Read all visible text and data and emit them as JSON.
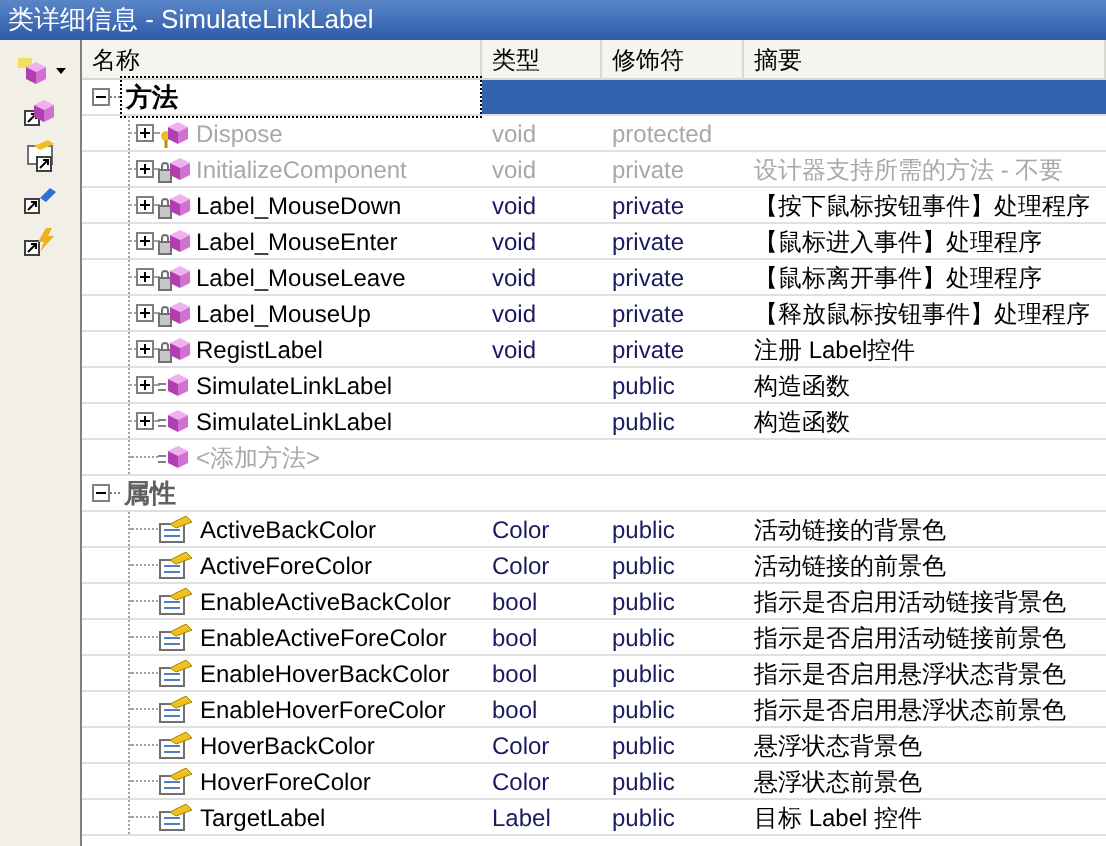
{
  "window": {
    "title": "类详细信息 - SimulateLinkLabel"
  },
  "columns": [
    "名称",
    "类型",
    "修饰符",
    "摘要"
  ],
  "groups": [
    {
      "label": "方法",
      "expanded": true,
      "selected": true,
      "rows": [
        {
          "kind": "protected_method",
          "name": "Dispose",
          "type": "void",
          "modifier": "protected",
          "summary": "",
          "disabled": true
        },
        {
          "kind": "private_method",
          "name": "InitializeComponent",
          "type": "void",
          "modifier": "private",
          "summary": "设计器支持所需的方法 - 不要",
          "disabled": true
        },
        {
          "kind": "private_method",
          "name": "Label_MouseDown",
          "type": "void",
          "modifier": "private",
          "summary": "【按下鼠标按钮事件】处理程序",
          "disabled": false
        },
        {
          "kind": "private_method",
          "name": "Label_MouseEnter",
          "type": "void",
          "modifier": "private",
          "summary": "【鼠标进入事件】处理程序",
          "disabled": false
        },
        {
          "kind": "private_method",
          "name": "Label_MouseLeave",
          "type": "void",
          "modifier": "private",
          "summary": "【鼠标离开事件】处理程序",
          "disabled": false
        },
        {
          "kind": "private_method",
          "name": "Label_MouseUp",
          "type": "void",
          "modifier": "private",
          "summary": "【释放鼠标按钮事件】处理程序",
          "disabled": false
        },
        {
          "kind": "private_method",
          "name": "RegistLabel",
          "type": "void",
          "modifier": "private",
          "summary": "注册 Label控件",
          "disabled": false
        },
        {
          "kind": "public_method",
          "name": "SimulateLinkLabel",
          "type": "",
          "modifier": "public",
          "summary": "构造函数",
          "disabled": false
        },
        {
          "kind": "public_method",
          "name": "SimulateLinkLabel",
          "type": "",
          "modifier": "public",
          "summary": "构造函数",
          "disabled": false
        },
        {
          "kind": "add_method",
          "name": "<添加方法>",
          "type": "",
          "modifier": "",
          "summary": "",
          "disabled": true
        }
      ]
    },
    {
      "label": "属性",
      "expanded": true,
      "selected": false,
      "rows": [
        {
          "kind": "property",
          "name": "ActiveBackColor",
          "type": "Color",
          "modifier": "public",
          "summary": "活动链接的背景色",
          "disabled": false
        },
        {
          "kind": "property",
          "name": "ActiveForeColor",
          "type": "Color",
          "modifier": "public",
          "summary": "活动链接的前景色",
          "disabled": false
        },
        {
          "kind": "property",
          "name": "EnableActiveBackColor",
          "type": "bool",
          "modifier": "public",
          "summary": "指示是否启用活动链接背景色",
          "disabled": false
        },
        {
          "kind": "property",
          "name": "EnableActiveForeColor",
          "type": "bool",
          "modifier": "public",
          "summary": "指示是否启用活动链接前景色",
          "disabled": false
        },
        {
          "kind": "property",
          "name": "EnableHoverBackColor",
          "type": "bool",
          "modifier": "public",
          "summary": "指示是否启用悬浮状态背景色",
          "disabled": false
        },
        {
          "kind": "property",
          "name": "EnableHoverForeColor",
          "type": "bool",
          "modifier": "public",
          "summary": "指示是否启用悬浮状态前景色",
          "disabled": false
        },
        {
          "kind": "property",
          "name": "HoverBackColor",
          "type": "Color",
          "modifier": "public",
          "summary": "悬浮状态背景色",
          "disabled": false
        },
        {
          "kind": "property",
          "name": "HoverForeColor",
          "type": "Color",
          "modifier": "public",
          "summary": "悬浮状态前景色",
          "disabled": false
        },
        {
          "kind": "property",
          "name": "TargetLabel",
          "type": "Label",
          "modifier": "public",
          "summary": "目标 Label 控件",
          "disabled": false
        }
      ]
    }
  ]
}
